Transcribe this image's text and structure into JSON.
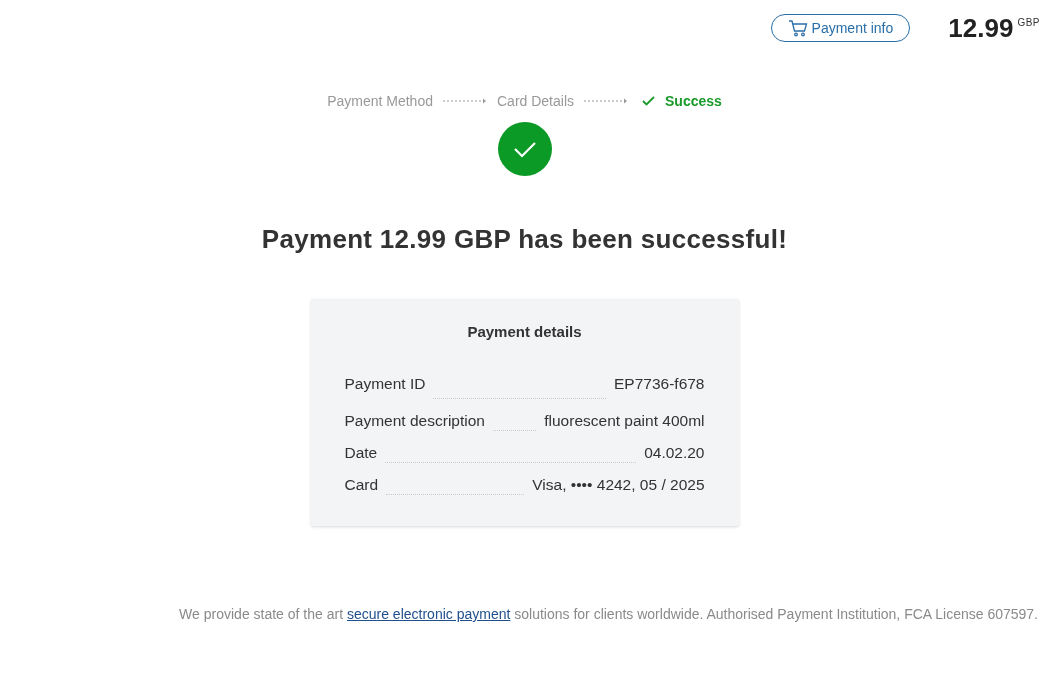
{
  "header": {
    "payment_info_button": "Payment info",
    "amount": "12.99",
    "currency": "GBP"
  },
  "steps": [
    {
      "label": "Payment Method",
      "selected": false
    },
    {
      "label": "Card Details",
      "selected": false
    },
    {
      "label": "Success",
      "selected": true
    }
  ],
  "heading": "Payment 12.99 GBP has been successful!",
  "details": {
    "title": "Payment details",
    "rows": [
      {
        "label": "Payment ID",
        "value": "EP7736-f678"
      },
      {
        "label": "Payment description",
        "value": "fluorescent paint 400ml"
      },
      {
        "label": "Date",
        "value": "04.02.20"
      },
      {
        "label": "Card",
        "value": "Visa, •••• 4242, 05 / 2025"
      }
    ]
  },
  "footer": {
    "before": "We provide state of the art ",
    "link": "secure electronic payment",
    "after": " solutions for clients worldwide. Authorised Payment Institution, FCA License 607597."
  }
}
